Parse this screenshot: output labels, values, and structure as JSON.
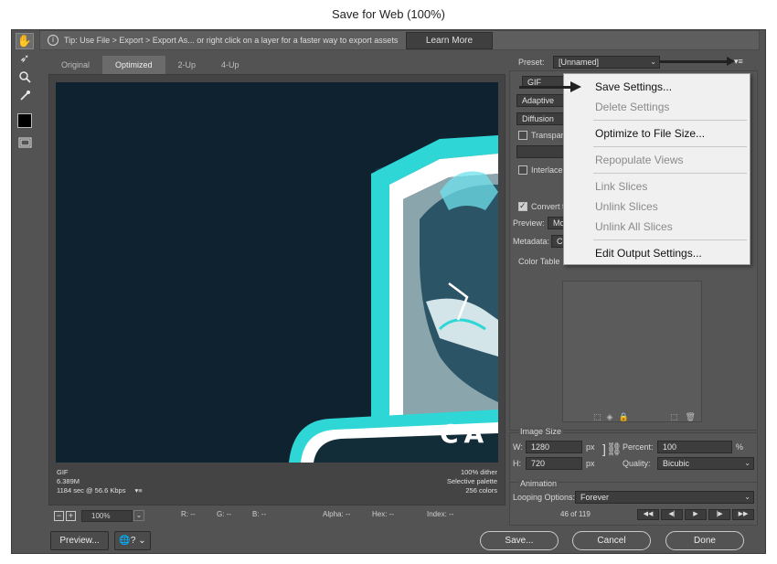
{
  "window": {
    "title": "Save for Web (100%)"
  },
  "tools": [
    {
      "name": "hand-tool-icon",
      "glyph": "✋"
    },
    {
      "name": "slice-select-tool-icon",
      "glyph": "➶"
    },
    {
      "name": "zoom-tool-icon",
      "glyph": "🔍"
    },
    {
      "name": "eyedropper-tool-icon",
      "glyph": "✒"
    },
    {
      "name": "color-swatch",
      "glyph": ""
    },
    {
      "name": "toggle-slices-icon",
      "glyph": "▣"
    }
  ],
  "tip": {
    "text": "Tip: Use File > Export > Export As... or right click on a layer for a faster way to export assets",
    "learn_more": "Learn More"
  },
  "tabs": [
    "Original",
    "Optimized",
    "2-Up",
    "4-Up"
  ],
  "preview": {
    "info_left": [
      "GIF",
      "6.389M",
      "1184 sec @ 56.6 Kbps"
    ],
    "info_right": [
      "100% dither",
      "Selective palette",
      "256 colors"
    ],
    "logo_text": "CA"
  },
  "status": {
    "zoom": "100%",
    "r": "R: --",
    "g": "G: --",
    "b": "B: --",
    "alpha": "Alpha: --",
    "hex": "Hex: --",
    "index": "Index: --"
  },
  "buttons": {
    "preview": "Preview...",
    "save": "Save...",
    "cancel": "Cancel",
    "done": "Done"
  },
  "settings": {
    "preset_label": "Preset:",
    "preset_value": "[Unnamed]",
    "format": "GIF",
    "reduction": "Adaptive",
    "dither": "Diffusion",
    "transparency": "Transpar",
    "interlaced": "Interlace",
    "convert": "Convert t",
    "preview_label": "Preview:",
    "preview_value": "Mor",
    "metadata_label": "Metadata:",
    "metadata_value": "Co",
    "color_table": "Color Table"
  },
  "menu": {
    "items": [
      "Save Settings...",
      "Delete Settings",
      "Optimize to File Size...",
      "Repopulate Views",
      "Link Slices",
      "Unlink Slices",
      "Unlink All Slices",
      "Edit Output Settings..."
    ],
    "disabled": [
      false,
      true,
      false,
      true,
      true,
      true,
      true,
      false
    ]
  },
  "image_size": {
    "title": "Image Size",
    "w_label": "W:",
    "w": "1280",
    "h_label": "H:",
    "h": "720",
    "unit": "px",
    "percent_label": "Percent:",
    "percent": "100",
    "percent_unit": "%",
    "quality_label": "Quality:",
    "quality": "Bicubic"
  },
  "animation": {
    "title": "Animation",
    "looping_label": "Looping Options:",
    "looping": "Forever",
    "frame": "46 of 119"
  },
  "colors": {
    "accent_cyan": "#2fd6d6",
    "canvas_bg": "#0e2230",
    "panel_bg": "#535353"
  }
}
